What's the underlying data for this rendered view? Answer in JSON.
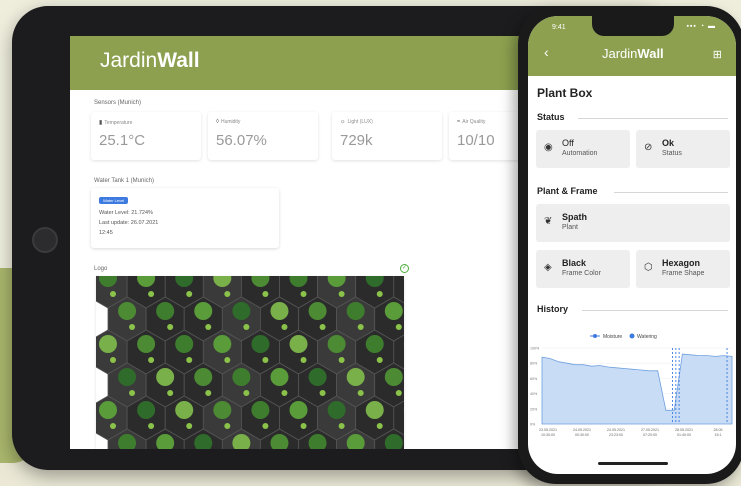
{
  "tablet": {
    "logo_part1": "Jardin",
    "logo_part2": "Wall",
    "sensors_title": "Sensors (Munich)",
    "sensors": [
      {
        "label": "Temperature",
        "value": "25.1°C",
        "icon": "thermometer-icon"
      },
      {
        "label": "Humidity",
        "value": "56.07%",
        "icon": "droplet-icon"
      },
      {
        "label": "Light (LUX)",
        "value": "729k",
        "icon": "sun-icon"
      },
      {
        "label": "Air Quality",
        "value": "10/10",
        "icon": "wind-icon"
      }
    ],
    "tank_title": "Water Tank 1 (Munich)",
    "tank": {
      "badge": "Water Level",
      "level": "Water Level: 21.724%",
      "update": "Last update: 26.07.2021",
      "time": "12:45"
    },
    "logo_section_title": "Logo",
    "colors": {
      "accent": "#8ca04f",
      "badge": "#3d7be0",
      "ok": "#4fae3d"
    }
  },
  "phone": {
    "time": "9:41",
    "back_icon": "chevron-left-icon",
    "grid_icon": "grid-icon",
    "logo_part1": "Jardin",
    "logo_part2": "Wall",
    "title": "Plant Box",
    "status_title": "Status",
    "automation": {
      "value": "Off",
      "label": "Automation",
      "icon": "power-icon"
    },
    "status": {
      "value": "Ok",
      "label": "Status",
      "icon": "check-circle-icon"
    },
    "plant_frame_title": "Plant & Frame",
    "plant": {
      "value": "Spath",
      "label": "Plant",
      "icon": "plant-icon"
    },
    "frame_color": {
      "value": "Black",
      "label": "Frame Color",
      "icon": "paint-bucket-icon"
    },
    "frame_shape": {
      "value": "Hexagon",
      "label": "Frame Shape",
      "icon": "hexagon-icon"
    },
    "history_title": "History"
  },
  "chart_data": {
    "type": "area",
    "title": "",
    "xlabel": "",
    "ylabel": "",
    "legend": "top",
    "series": [
      {
        "name": "Moisture",
        "color": "#3d7be0",
        "x": [
          0,
          0.5,
          1,
          1.5,
          2,
          2.5,
          3,
          3.5,
          4,
          4.5,
          5,
          5.5,
          6,
          6.5,
          7,
          7.5,
          8,
          8.5,
          9,
          9.5,
          10,
          10.5,
          11,
          11.5
        ],
        "values": [
          88,
          86,
          82,
          80,
          78,
          78,
          76,
          77,
          75,
          74,
          73,
          72,
          71,
          70,
          70,
          18,
          18,
          92,
          91,
          90,
          90,
          89,
          90,
          89
        ]
      },
      {
        "name": "Watering",
        "color": "#3d7be0",
        "style": "dashed-vertical",
        "x": [
          7.9,
          8.1,
          8.3,
          11.2
        ]
      }
    ],
    "yticks": [
      "0%",
      "20%",
      "40%",
      "60%",
      "80%",
      "100%"
    ],
    "ylim": [
      0,
      100
    ],
    "xticks": [
      {
        "date": "23.05.2021",
        "time": "10:30:00"
      },
      {
        "date": "24.05.2021",
        "time": "00:30:00"
      },
      {
        "date": "24.05.2021",
        "time": "23:23:00"
      },
      {
        "date": "27.05.2021",
        "time": "07:20:00"
      },
      {
        "date": "28.05.2021",
        "time": "01:40:00"
      },
      {
        "date": "28.05",
        "time": "15:1"
      }
    ]
  }
}
